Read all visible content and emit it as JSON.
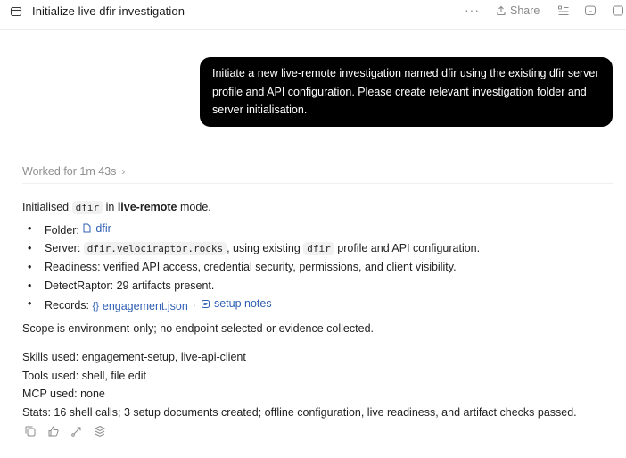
{
  "header": {
    "title": "Initialize live dfir investigation",
    "more_label": "···",
    "share_label": "Share"
  },
  "user_message": {
    "text": "Initiate a new live-remote investigation named dfir using the existing dfir server profile and API configuration. Please create relevant investigation folder and server initialisation."
  },
  "worked": {
    "label": "Worked for 1m 43s",
    "chevron": "›"
  },
  "response": {
    "intro_prefix": "Initialised",
    "intro_code": "dfir",
    "intro_mid": "in",
    "intro_mode": "live-remote",
    "intro_suffix": "mode.",
    "folder_label": "Folder:",
    "folder_link": "dfir",
    "server_label": "Server:",
    "server_code": "dfir.velociraptor.rocks",
    "server_mid": ", using existing",
    "server_code2": "dfir",
    "server_suffix": "profile and API configuration.",
    "readiness": "Readiness: verified API access, credential security, permissions, and client visibility.",
    "detectraptor": "DetectRaptor: 29 artifacts present.",
    "records_label": "Records:",
    "records_link1": "engagement.json",
    "records_sep": "·",
    "records_link2": "setup notes",
    "scope": "Scope is environment-only; no endpoint selected or evidence collected.",
    "skills": "Skills used: engagement-setup, live-api-client",
    "tools": "Tools used: shell, file edit",
    "mcp": "MCP used: none",
    "stats": "Stats: 16 shell calls; 3 setup documents created; offline configuration, live readiness, and artifact checks passed."
  },
  "icons": {
    "thread": "folder-icon",
    "share": "share-icon",
    "list": "list-icon",
    "chat": "chat-icon",
    "panel": "panel-icon",
    "copy": "copy-icon",
    "feedback": "thumbs-icon",
    "branch": "branch-icon",
    "stack": "stack-icon"
  },
  "colors": {
    "link": "#2f5fb3",
    "user_bubble": "#000000",
    "muted": "#8f8f8f"
  }
}
